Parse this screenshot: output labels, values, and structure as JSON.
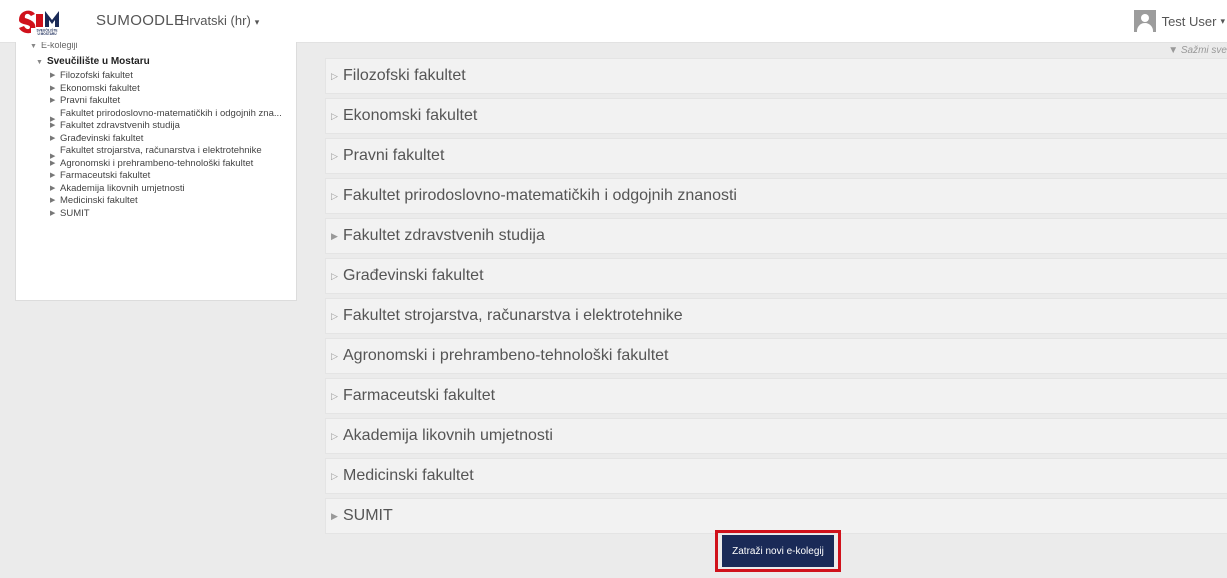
{
  "header": {
    "brand": "SUMOODLE",
    "language": "Hrvatski (hr)",
    "user_name": "Test User"
  },
  "sidebar": {
    "root": "E-kolegiji",
    "parent": "Sveučilište u Mostaru",
    "items": [
      {
        "label": "Filozofski fakultet"
      },
      {
        "label": "Ekonomski fakultet"
      },
      {
        "label": "Pravni fakultet"
      },
      {
        "label": "Fakultet prirodoslovno-matematičkih i odgojnih zna..."
      },
      {
        "label": "Fakultet zdravstvenih studija"
      },
      {
        "label": "Građevinski fakultet"
      },
      {
        "label": "Fakultet strojarstva, računarstva i elektrotehnike"
      },
      {
        "label": "Agronomski i prehrambeno-tehnološki fakultet"
      },
      {
        "label": "Farmaceutski fakultet"
      },
      {
        "label": "Akademija likovnih umjetnosti"
      },
      {
        "label": "Medicinski fakultet"
      },
      {
        "label": "SUMIT"
      }
    ]
  },
  "main": {
    "collapse_label": "Sažmi sve",
    "categories": [
      {
        "label": "Filozofski fakultet"
      },
      {
        "label": "Ekonomski fakultet"
      },
      {
        "label": "Pravni fakultet"
      },
      {
        "label": "Fakultet prirodoslovno-matematičkih i odgojnih znanosti"
      },
      {
        "label": "Fakultet zdravstvenih studija"
      },
      {
        "label": "Građevinski fakultet"
      },
      {
        "label": "Fakultet strojarstva, računarstva i elektrotehnike"
      },
      {
        "label": "Agronomski i prehrambeno-tehnološki fakultet"
      },
      {
        "label": "Farmaceutski fakultet"
      },
      {
        "label": "Akademija likovnih umjetnosti"
      },
      {
        "label": "Medicinski fakultet"
      },
      {
        "label": "SUMIT"
      }
    ],
    "request_button": "Zatraži novi e-kolegij"
  },
  "icons": {
    "collapsed": "triangle-right-icon",
    "expanded": "triangle-down-icon",
    "user": "user-avatar-icon"
  },
  "colors": {
    "button_bg": "#1a2a57",
    "highlight_border": "#d0111b",
    "logo_red": "#d0111b",
    "logo_navy": "#1a2a57"
  }
}
